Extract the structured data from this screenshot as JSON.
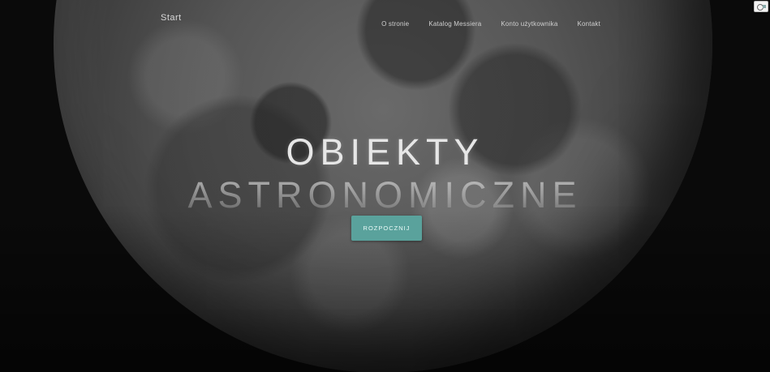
{
  "nav": {
    "brand": "Start",
    "items": [
      {
        "label": "O stronie"
      },
      {
        "label": "Katalog Messiera"
      },
      {
        "label": "Konto użytkownika"
      },
      {
        "label": "Kontakt"
      }
    ]
  },
  "hero": {
    "title": "OBIEKTY",
    "subtitle": "ASTRONOMICZNE",
    "cta_label": "ROZPOCZNIJ"
  },
  "colors": {
    "accent": "#5aa29c",
    "background": "#0a0a0a"
  },
  "icons": {
    "corner": "browser-extension-icon"
  }
}
